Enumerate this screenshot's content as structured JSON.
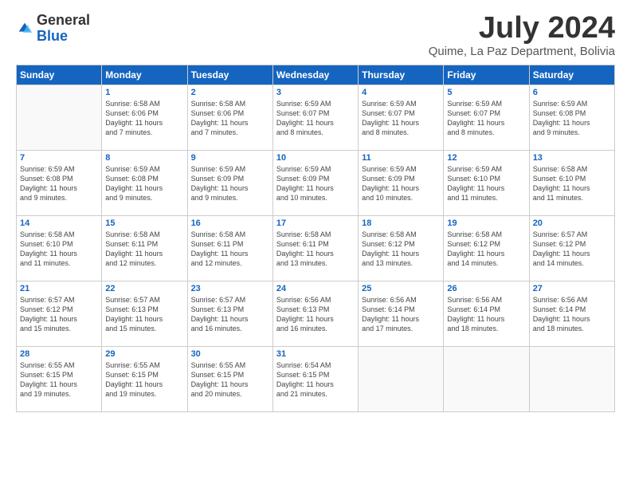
{
  "logo": {
    "general": "General",
    "blue": "Blue"
  },
  "header": {
    "month_year": "July 2024",
    "location": "Quime, La Paz Department, Bolivia"
  },
  "weekdays": [
    "Sunday",
    "Monday",
    "Tuesday",
    "Wednesday",
    "Thursday",
    "Friday",
    "Saturday"
  ],
  "weeks": [
    [
      {
        "day": "",
        "info": ""
      },
      {
        "day": "1",
        "info": "Sunrise: 6:58 AM\nSunset: 6:06 PM\nDaylight: 11 hours\nand 7 minutes."
      },
      {
        "day": "2",
        "info": "Sunrise: 6:58 AM\nSunset: 6:06 PM\nDaylight: 11 hours\nand 7 minutes."
      },
      {
        "day": "3",
        "info": "Sunrise: 6:59 AM\nSunset: 6:07 PM\nDaylight: 11 hours\nand 8 minutes."
      },
      {
        "day": "4",
        "info": "Sunrise: 6:59 AM\nSunset: 6:07 PM\nDaylight: 11 hours\nand 8 minutes."
      },
      {
        "day": "5",
        "info": "Sunrise: 6:59 AM\nSunset: 6:07 PM\nDaylight: 11 hours\nand 8 minutes."
      },
      {
        "day": "6",
        "info": "Sunrise: 6:59 AM\nSunset: 6:08 PM\nDaylight: 11 hours\nand 9 minutes."
      }
    ],
    [
      {
        "day": "7",
        "info": "Sunrise: 6:59 AM\nSunset: 6:08 PM\nDaylight: 11 hours\nand 9 minutes."
      },
      {
        "day": "8",
        "info": "Sunrise: 6:59 AM\nSunset: 6:08 PM\nDaylight: 11 hours\nand 9 minutes."
      },
      {
        "day": "9",
        "info": "Sunrise: 6:59 AM\nSunset: 6:09 PM\nDaylight: 11 hours\nand 9 minutes."
      },
      {
        "day": "10",
        "info": "Sunrise: 6:59 AM\nSunset: 6:09 PM\nDaylight: 11 hours\nand 10 minutes."
      },
      {
        "day": "11",
        "info": "Sunrise: 6:59 AM\nSunset: 6:09 PM\nDaylight: 11 hours\nand 10 minutes."
      },
      {
        "day": "12",
        "info": "Sunrise: 6:59 AM\nSunset: 6:10 PM\nDaylight: 11 hours\nand 11 minutes."
      },
      {
        "day": "13",
        "info": "Sunrise: 6:58 AM\nSunset: 6:10 PM\nDaylight: 11 hours\nand 11 minutes."
      }
    ],
    [
      {
        "day": "14",
        "info": "Sunrise: 6:58 AM\nSunset: 6:10 PM\nDaylight: 11 hours\nand 11 minutes."
      },
      {
        "day": "15",
        "info": "Sunrise: 6:58 AM\nSunset: 6:11 PM\nDaylight: 11 hours\nand 12 minutes."
      },
      {
        "day": "16",
        "info": "Sunrise: 6:58 AM\nSunset: 6:11 PM\nDaylight: 11 hours\nand 12 minutes."
      },
      {
        "day": "17",
        "info": "Sunrise: 6:58 AM\nSunset: 6:11 PM\nDaylight: 11 hours\nand 13 minutes."
      },
      {
        "day": "18",
        "info": "Sunrise: 6:58 AM\nSunset: 6:12 PM\nDaylight: 11 hours\nand 13 minutes."
      },
      {
        "day": "19",
        "info": "Sunrise: 6:58 AM\nSunset: 6:12 PM\nDaylight: 11 hours\nand 14 minutes."
      },
      {
        "day": "20",
        "info": "Sunrise: 6:57 AM\nSunset: 6:12 PM\nDaylight: 11 hours\nand 14 minutes."
      }
    ],
    [
      {
        "day": "21",
        "info": "Sunrise: 6:57 AM\nSunset: 6:12 PM\nDaylight: 11 hours\nand 15 minutes."
      },
      {
        "day": "22",
        "info": "Sunrise: 6:57 AM\nSunset: 6:13 PM\nDaylight: 11 hours\nand 15 minutes."
      },
      {
        "day": "23",
        "info": "Sunrise: 6:57 AM\nSunset: 6:13 PM\nDaylight: 11 hours\nand 16 minutes."
      },
      {
        "day": "24",
        "info": "Sunrise: 6:56 AM\nSunset: 6:13 PM\nDaylight: 11 hours\nand 16 minutes."
      },
      {
        "day": "25",
        "info": "Sunrise: 6:56 AM\nSunset: 6:14 PM\nDaylight: 11 hours\nand 17 minutes."
      },
      {
        "day": "26",
        "info": "Sunrise: 6:56 AM\nSunset: 6:14 PM\nDaylight: 11 hours\nand 18 minutes."
      },
      {
        "day": "27",
        "info": "Sunrise: 6:56 AM\nSunset: 6:14 PM\nDaylight: 11 hours\nand 18 minutes."
      }
    ],
    [
      {
        "day": "28",
        "info": "Sunrise: 6:55 AM\nSunset: 6:15 PM\nDaylight: 11 hours\nand 19 minutes."
      },
      {
        "day": "29",
        "info": "Sunrise: 6:55 AM\nSunset: 6:15 PM\nDaylight: 11 hours\nand 19 minutes."
      },
      {
        "day": "30",
        "info": "Sunrise: 6:55 AM\nSunset: 6:15 PM\nDaylight: 11 hours\nand 20 minutes."
      },
      {
        "day": "31",
        "info": "Sunrise: 6:54 AM\nSunset: 6:15 PM\nDaylight: 11 hours\nand 21 minutes."
      },
      {
        "day": "",
        "info": ""
      },
      {
        "day": "",
        "info": ""
      },
      {
        "day": "",
        "info": ""
      }
    ]
  ]
}
